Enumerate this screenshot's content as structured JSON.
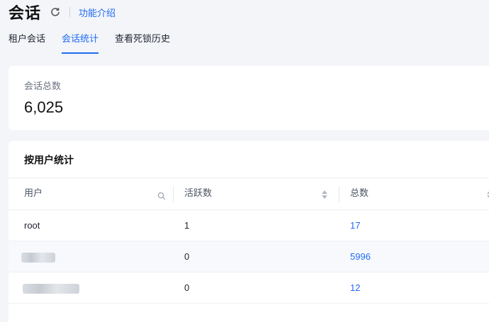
{
  "header": {
    "title": "会话",
    "refresh_icon": "refresh-icon",
    "intro_link": "功能介绍"
  },
  "tabs": [
    {
      "label": "租户会话",
      "active": false
    },
    {
      "label": "会话统计",
      "active": true
    },
    {
      "label": "查看死锁历史",
      "active": false
    }
  ],
  "summary": {
    "label": "会话总数",
    "value": "6,025"
  },
  "stats": {
    "title": "按用户统计",
    "columns": [
      {
        "label": "用户",
        "icon": "search-icon"
      },
      {
        "label": "活跃数",
        "icon": "sort-icon"
      },
      {
        "label": "总数",
        "icon": "sort-icon"
      }
    ],
    "rows": [
      {
        "user": "root",
        "active": "1",
        "total": "17"
      },
      {
        "user": "",
        "active": "0",
        "total": "5996"
      },
      {
        "user": "",
        "active": "0",
        "total": "12"
      }
    ]
  },
  "colors": {
    "accent": "#1f6bf4",
    "background": "#f3f5f9",
    "card": "#ffffff"
  }
}
